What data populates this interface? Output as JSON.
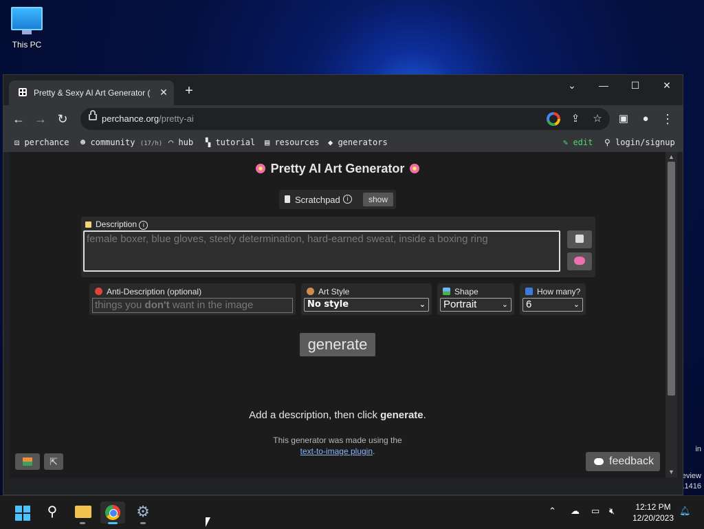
{
  "desktop": {
    "icon_label": "This PC",
    "side_text_1": "in",
    "side_text_2": "eview",
    "side_text_3": ".1416"
  },
  "browser": {
    "tab_title": "Pretty & Sexy AI Art Generator (fr",
    "url_host": "perchance.org",
    "url_path": "/pretty-ai",
    "bookmarks": [
      {
        "label": "perchance"
      },
      {
        "label": "community",
        "badge": "(17/h)"
      },
      {
        "label": "hub"
      },
      {
        "label": "tutorial"
      },
      {
        "label": "resources"
      },
      {
        "label": "generators"
      }
    ],
    "edit_label": "edit",
    "login_label": "login/signup"
  },
  "page": {
    "title": "Pretty AI Art Generator",
    "scratchpad_label": "Scratchpad",
    "show_label": "show",
    "description_label": "Description",
    "description_placeholder": "female boxer, blue gloves, steely determination, hard-earned sweat, inside a boxing ring",
    "anti_label": "Anti-Description (optional)",
    "anti_placeholder_1": "things you ",
    "anti_placeholder_bold": "don't",
    "anti_placeholder_2": " want in the image",
    "art_style_label": "Art Style",
    "art_style_value": "No style",
    "shape_label": "Shape",
    "shape_value": "Portrait",
    "how_many_label": "How many?",
    "how_many_value": "6",
    "generate_label": "generate",
    "message_prefix": "Add a description, then click ",
    "message_bold": "generate",
    "message_suffix": ".",
    "made_with": "This generator was made using the",
    "plugin_link": "text-to-image plugin",
    "plugin_suffix": ".",
    "feedback_label": "feedback"
  },
  "taskbar": {
    "time": "12:12 PM",
    "date": "12/20/2023"
  }
}
